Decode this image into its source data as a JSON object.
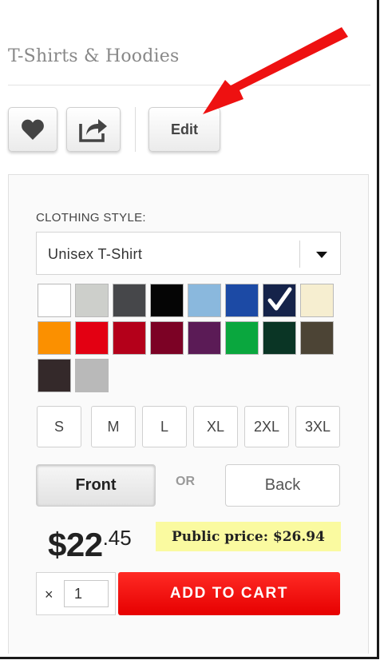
{
  "product": {
    "title": "T-Shirts & Hoodies"
  },
  "toolbar": {
    "favorite_icon": "heart-icon",
    "share_icon": "share-icon",
    "edit_label": "Edit"
  },
  "clothing": {
    "label": "CLOTHING STYLE:",
    "selected_style": "Unisex T-Shirt"
  },
  "colors": {
    "selected_index": 6,
    "swatches": [
      "#ffffff",
      "#cdcfcb",
      "#46474a",
      "#050505",
      "#8ab8dd",
      "#1c4aa5",
      "#15234a",
      "#f6eed0",
      "#fb9000",
      "#e30012",
      "#b4001a",
      "#7c0225",
      "#5b1b56",
      "#0aa73e",
      "#0a3525",
      "#4c4435",
      "#34292a",
      "#b9b9b9"
    ]
  },
  "sizes": [
    "S",
    "M",
    "L",
    "XL",
    "2XL",
    "3XL"
  ],
  "view": {
    "front_label": "Front",
    "or_label": "OR",
    "back_label": "Back",
    "selected": "Front"
  },
  "pricing": {
    "dollars": "$22",
    "cents": ".45",
    "public_price": "Public price: $26.94"
  },
  "cart": {
    "multiplier": "×",
    "quantity": "1",
    "add_label": "ADD TO CART"
  }
}
